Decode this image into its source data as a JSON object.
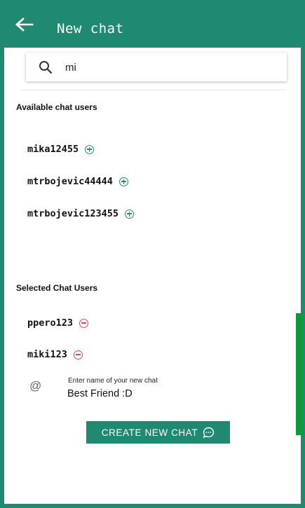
{
  "header": {
    "title": "New chat",
    "back_icon": "arrow-left-icon"
  },
  "search": {
    "value": "mi",
    "icon": "search-icon"
  },
  "available": {
    "heading": "Available chat users",
    "users": [
      {
        "name": "mika12455"
      },
      {
        "name": "mtrbojevic44444"
      },
      {
        "name": "mtrbojevic123455"
      }
    ]
  },
  "selected": {
    "heading": "Selected Chat Users",
    "users": [
      {
        "name": "ppero123"
      },
      {
        "name": "miki123"
      }
    ]
  },
  "chat_name": {
    "icon": "@",
    "label": "Enter name of your new chat",
    "value": "Best Friend :D"
  },
  "create_button": {
    "label": "CREATE NEW CHAT",
    "icon": "chat-bubble-icon"
  },
  "colors": {
    "primary": "#1f8a70",
    "add": "#1f8a70",
    "remove": "#e0435a",
    "scrollbar": "#0c9a3a"
  }
}
